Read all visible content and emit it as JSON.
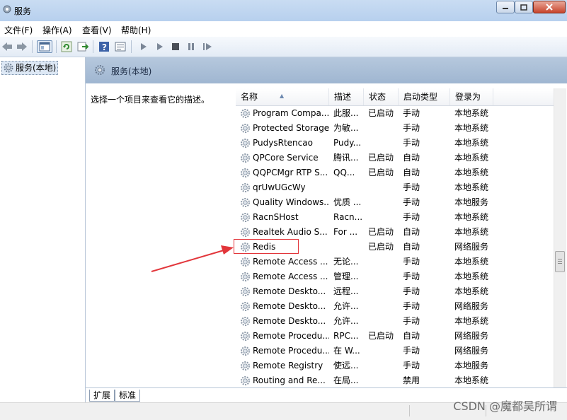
{
  "window": {
    "title": "服务"
  },
  "menu": [
    "文件(F)",
    "操作(A)",
    "查看(V)",
    "帮助(H)"
  ],
  "tree": {
    "item": "服务(本地)"
  },
  "pane": {
    "title": "服务(本地)",
    "description_hint": "选择一个项目来查看它的描述。"
  },
  "columns": [
    "名称",
    "描述",
    "状态",
    "启动类型",
    "登录为"
  ],
  "services": [
    {
      "name": "Program Compa...",
      "desc": "此服...",
      "status": "已启动",
      "start": "手动",
      "logon": "本地系统"
    },
    {
      "name": "Protected Storage",
      "desc": "为敏...",
      "status": "",
      "start": "手动",
      "logon": "本地系统"
    },
    {
      "name": "PudysRtencao",
      "desc": "Pudy...",
      "status": "",
      "start": "手动",
      "logon": "本地系统"
    },
    {
      "name": "QPCore Service",
      "desc": "腾讯...",
      "status": "已启动",
      "start": "自动",
      "logon": "本地系统"
    },
    {
      "name": "QQPCMgr RTP S...",
      "desc": "QQ...",
      "status": "已启动",
      "start": "自动",
      "logon": "本地系统"
    },
    {
      "name": "qrUwUGcWy",
      "desc": "",
      "status": "",
      "start": "手动",
      "logon": "本地系统"
    },
    {
      "name": "Quality Windows...",
      "desc": "优质 ...",
      "status": "",
      "start": "手动",
      "logon": "本地服务"
    },
    {
      "name": "RacnSHost",
      "desc": "Racn...",
      "status": "",
      "start": "手动",
      "logon": "本地系统"
    },
    {
      "name": "Realtek Audio S...",
      "desc": "For ...",
      "status": "已启动",
      "start": "自动",
      "logon": "本地系统"
    },
    {
      "name": "Redis",
      "desc": "",
      "status": "已启动",
      "start": "自动",
      "logon": "网络服务"
    },
    {
      "name": "Remote Access ...",
      "desc": "无论...",
      "status": "",
      "start": "手动",
      "logon": "本地系统"
    },
    {
      "name": "Remote Access ...",
      "desc": "管理...",
      "status": "",
      "start": "手动",
      "logon": "本地系统"
    },
    {
      "name": "Remote Deskto...",
      "desc": "远程...",
      "status": "",
      "start": "手动",
      "logon": "本地系统"
    },
    {
      "name": "Remote Deskto...",
      "desc": "允许...",
      "status": "",
      "start": "手动",
      "logon": "网络服务"
    },
    {
      "name": "Remote Deskto...",
      "desc": "允许...",
      "status": "",
      "start": "手动",
      "logon": "本地系统"
    },
    {
      "name": "Remote Procedu...",
      "desc": "RPC...",
      "status": "已启动",
      "start": "自动",
      "logon": "网络服务"
    },
    {
      "name": "Remote Procedu...",
      "desc": "在 W...",
      "status": "",
      "start": "手动",
      "logon": "网络服务"
    },
    {
      "name": "Remote Registry",
      "desc": "使远...",
      "status": "",
      "start": "手动",
      "logon": "本地服务"
    },
    {
      "name": "Routing and Re...",
      "desc": "在局...",
      "status": "",
      "start": "禁用",
      "logon": "本地系统"
    }
  ],
  "tabs": [
    "扩展",
    "标准"
  ],
  "watermark": "CSDN @魔都吴所谓",
  "colors": {
    "highlight": "#e2353a",
    "arrow": "#e2353a"
  }
}
